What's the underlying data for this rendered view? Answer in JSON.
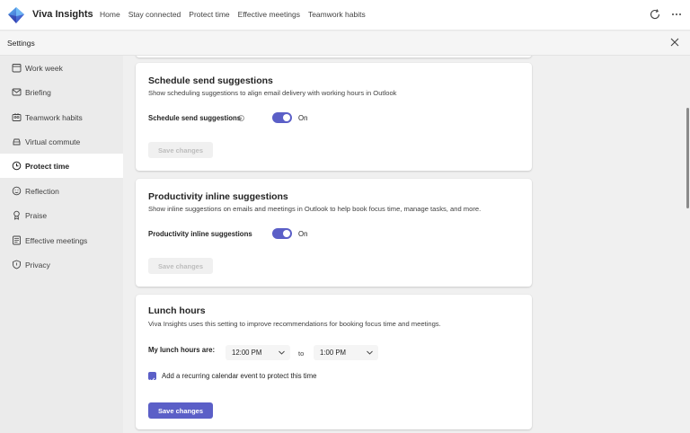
{
  "app": {
    "title": "Viva Insights"
  },
  "nav": [
    "Home",
    "Stay connected",
    "Protect time",
    "Effective meetings",
    "Teamwork habits"
  ],
  "settings": {
    "title": "Settings"
  },
  "sidebar": {
    "items": [
      {
        "label": "Work week",
        "icon": "calendar-icon"
      },
      {
        "label": "Briefing",
        "icon": "mail-icon"
      },
      {
        "label": "Teamwork habits",
        "icon": "people-icon"
      },
      {
        "label": "Virtual commute",
        "icon": "car-icon"
      },
      {
        "label": "Protect time",
        "icon": "clock-icon",
        "active": true
      },
      {
        "label": "Reflection",
        "icon": "emoji-icon"
      },
      {
        "label": "Praise",
        "icon": "ribbon-icon"
      },
      {
        "label": "Effective meetings",
        "icon": "document-icon"
      },
      {
        "label": "Privacy",
        "icon": "shield-icon"
      }
    ]
  },
  "schedule_send": {
    "title": "Schedule send suggestions",
    "description": "Show scheduling suggestions to align email delivery with working hours in Outlook",
    "row_label": "Schedule send suggestions",
    "toggle_state": "On",
    "save_label": "Save changes"
  },
  "productivity": {
    "title": "Productivity inline suggestions",
    "description": "Show inline suggestions on emails and meetings in Outlook to help book focus time, manage tasks, and more.",
    "row_label": "Productivity inline suggestions",
    "toggle_state": "On",
    "save_label": "Save changes"
  },
  "lunch": {
    "title": "Lunch hours",
    "description": "Viva Insights uses this setting to improve recommendations for booking focus time and meetings.",
    "row_label": "My lunch hours are:",
    "start": "12:00 PM",
    "to": "to",
    "end": "1:00 PM",
    "checkbox_label": "Add a recurring calendar event to protect this time",
    "save_label": "Save changes"
  },
  "colors": {
    "accent": "#5b5fc7"
  }
}
